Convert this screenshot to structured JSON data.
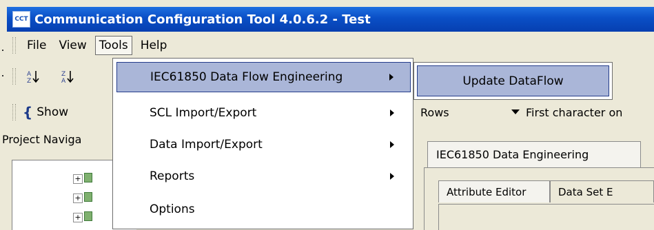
{
  "window": {
    "title": "Communication Configuration Tool 4.0.6.2 - Test",
    "icon_text": "CCT"
  },
  "menubar": {
    "items": [
      "File",
      "View",
      "Tools",
      "Help"
    ]
  },
  "toolbar2": {
    "show_label": "Show"
  },
  "filter": {
    "rows_label": "Rows",
    "first_char_label": "First character on"
  },
  "project_nav": {
    "label": "Project Naviga"
  },
  "tools_menu": {
    "items": [
      {
        "label": "IEC61850 Data Flow Engineering",
        "has_submenu": true,
        "highlighted": true
      },
      {
        "label": "SCL Import/Export",
        "has_submenu": true
      },
      {
        "label": "Data Import/Export",
        "has_submenu": true
      },
      {
        "label": "Reports",
        "has_submenu": true
      },
      {
        "label": "Options",
        "has_submenu": false
      }
    ]
  },
  "submenu": {
    "items": [
      {
        "label": "Update DataFlow"
      }
    ]
  },
  "tabs": {
    "main_tab": "IEC61850 Data Engineering",
    "sub_tabs": [
      "Attribute Editor",
      "Data Set E"
    ]
  }
}
